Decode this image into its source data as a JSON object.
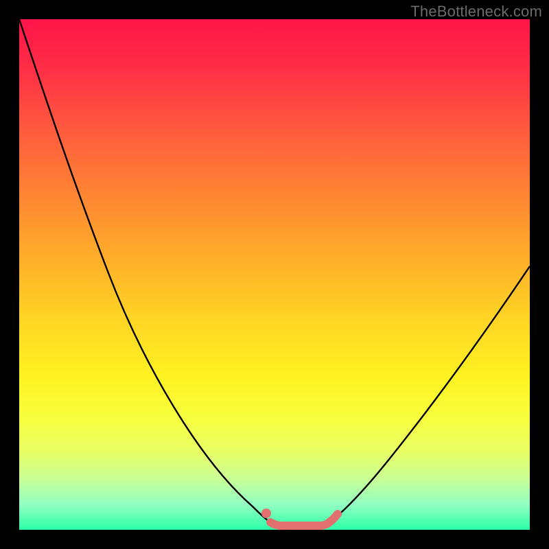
{
  "watermark": {
    "text": "TheBottleneck.com"
  },
  "colors": {
    "curve_stroke": "#000000",
    "optimal_stroke": "#e2706e",
    "background_black": "#000000"
  },
  "chart_data": {
    "type": "line",
    "title": "",
    "xlabel": "",
    "ylabel": "",
    "xlim": [
      0,
      100
    ],
    "ylim": [
      0,
      100
    ],
    "grid": false,
    "legend": false,
    "series": [
      {
        "name": "left-curve",
        "x": [
          0,
          5,
          10,
          15,
          20,
          25,
          30,
          35,
          40,
          45,
          48,
          50
        ],
        "values": [
          100,
          90,
          79,
          68,
          57,
          46,
          35,
          25,
          15,
          6,
          2,
          0
        ]
      },
      {
        "name": "flat-optimal",
        "x": [
          50,
          52,
          54,
          56,
          58,
          60
        ],
        "values": [
          0,
          0,
          0,
          0,
          0,
          0
        ]
      },
      {
        "name": "right-curve",
        "x": [
          60,
          65,
          70,
          75,
          80,
          85,
          90,
          95,
          100
        ],
        "values": [
          0,
          4,
          9,
          15,
          22,
          29,
          37,
          45,
          53
        ]
      }
    ],
    "markers": [
      {
        "name": "left-knee-dot",
        "x": 48,
        "y": 2
      },
      {
        "name": "right-knee-dot",
        "x": 60,
        "y": 0
      }
    ],
    "highlight_range": {
      "x_start": 48,
      "x_end": 60,
      "label": "optimal-zone"
    }
  }
}
